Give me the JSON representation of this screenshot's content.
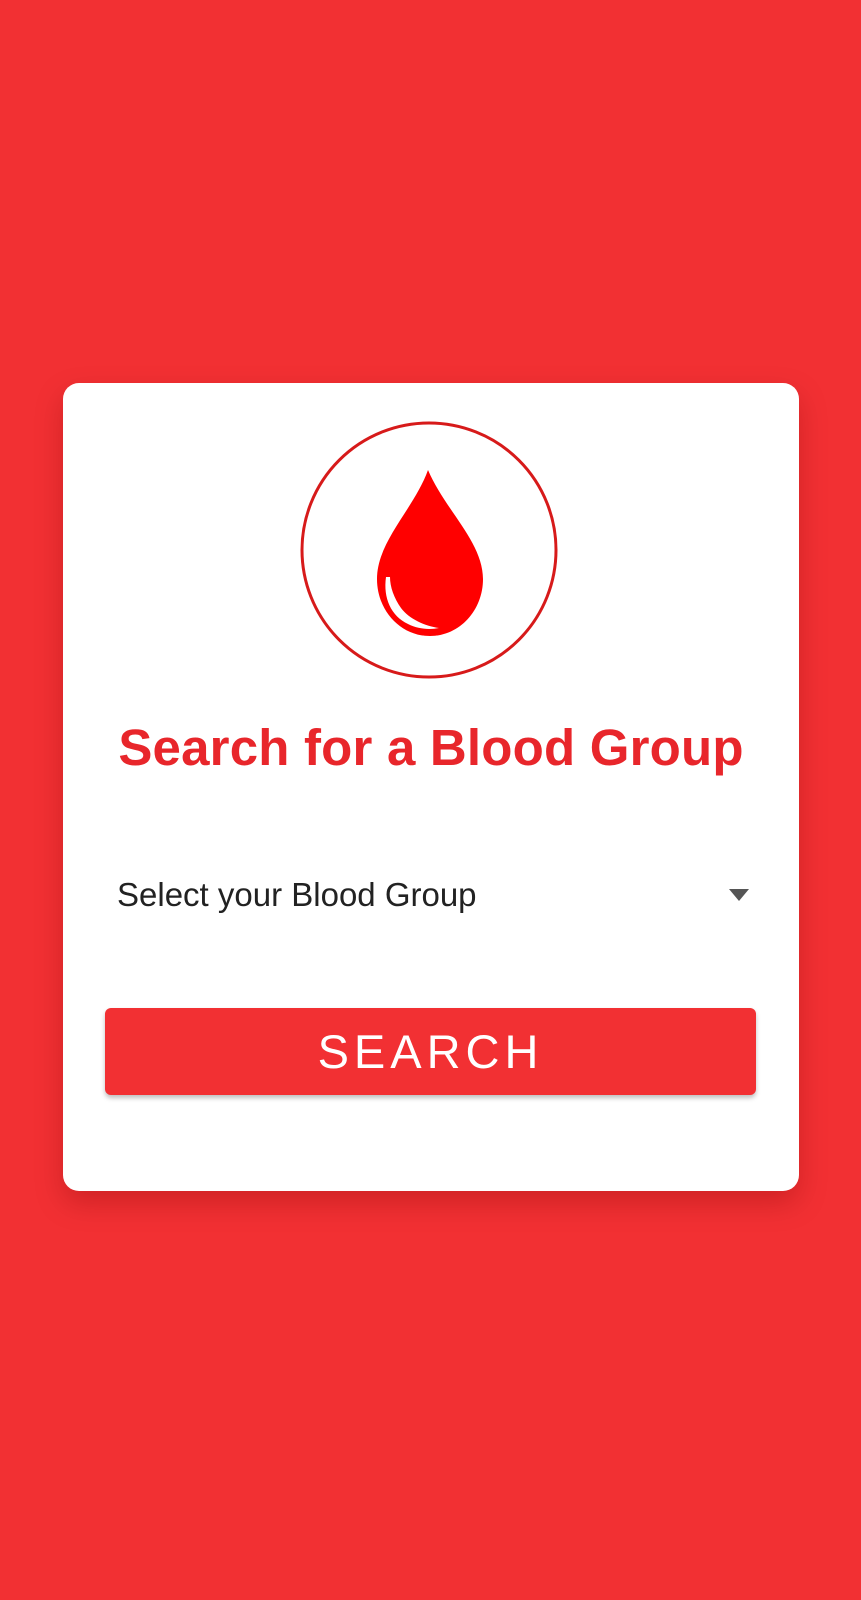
{
  "screen": {
    "background_color": "#f23033"
  },
  "card": {
    "background_color": "#ffffff",
    "logo_icon": "blood-drop-icon",
    "title": "Search for a Blood Group",
    "title_color": "#e8262b"
  },
  "blood_group_select": {
    "selected_label": "Select your Blood Group",
    "icon": "chevron-down-icon"
  },
  "search_button": {
    "label": "SEARCH",
    "color": "#f23033"
  }
}
